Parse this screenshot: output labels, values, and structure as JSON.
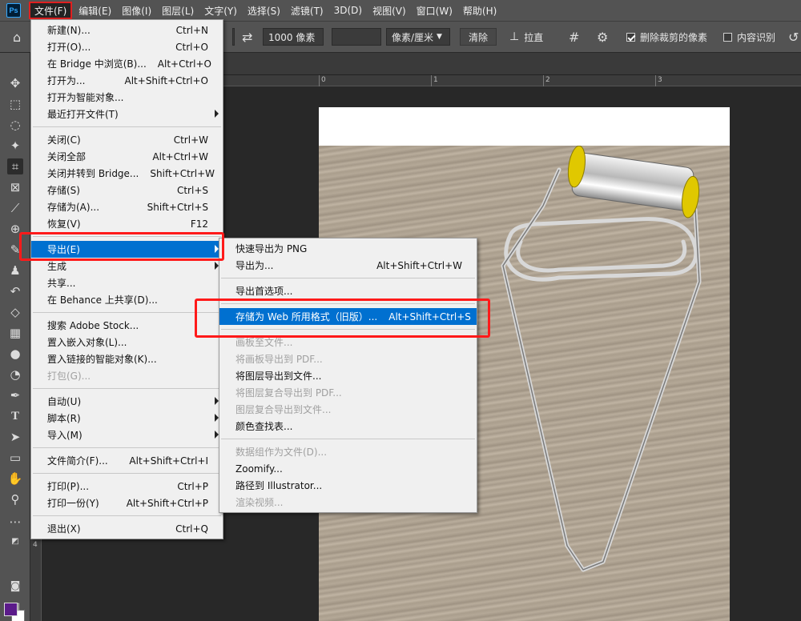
{
  "app": {
    "logo_text": "Ps"
  },
  "menubar": [
    "文件(F)",
    "编辑(E)",
    "图像(I)",
    "图层(L)",
    "文字(Y)",
    "选择(S)",
    "滤镜(T)",
    "3D(D)",
    "视图(V)",
    "窗口(W)",
    "帮助(H)"
  ],
  "options": {
    "height_value": "1000 像素",
    "unit_select": "像素/厘米",
    "clear_label": "清除",
    "straighten_label": "拉直",
    "delete_cropped_label": "删除裁剪的像素",
    "delete_cropped_checked": true,
    "content_aware_label": "内容识别",
    "content_aware_checked": false
  },
  "ruler": {
    "h0": "0",
    "h1": "1",
    "h2": "2",
    "h3": "3",
    "v4": "4"
  },
  "file_menu": [
    {
      "label": "新建(N)...",
      "shortcut": "Ctrl+N"
    },
    {
      "label": "打开(O)...",
      "shortcut": "Ctrl+O"
    },
    {
      "label": "在 Bridge 中浏览(B)...",
      "shortcut": "Alt+Ctrl+O"
    },
    {
      "label": "打开为...",
      "shortcut": "Alt+Shift+Ctrl+O"
    },
    {
      "label": "打开为智能对象...",
      "shortcut": ""
    },
    {
      "label": "最近打开文件(T)",
      "shortcut": "",
      "submenu": true
    },
    {
      "sep": true
    },
    {
      "label": "关闭(C)",
      "shortcut": "Ctrl+W"
    },
    {
      "label": "关闭全部",
      "shortcut": "Alt+Ctrl+W"
    },
    {
      "label": "关闭并转到 Bridge...",
      "shortcut": "Shift+Ctrl+W"
    },
    {
      "label": "存储(S)",
      "shortcut": "Ctrl+S"
    },
    {
      "label": "存储为(A)...",
      "shortcut": "Shift+Ctrl+S"
    },
    {
      "label": "恢复(V)",
      "shortcut": "F12"
    },
    {
      "sep": true
    },
    {
      "label": "导出(E)",
      "shortcut": "",
      "submenu": true,
      "highlighted": true
    },
    {
      "label": "生成",
      "shortcut": "",
      "submenu": true
    },
    {
      "label": "共享...",
      "shortcut": ""
    },
    {
      "label": "在 Behance 上共享(D)...",
      "shortcut": ""
    },
    {
      "sep": true
    },
    {
      "label": "搜索 Adobe Stock...",
      "shortcut": ""
    },
    {
      "label": "置入嵌入对象(L)...",
      "shortcut": ""
    },
    {
      "label": "置入链接的智能对象(K)...",
      "shortcut": ""
    },
    {
      "label": "打包(G)...",
      "shortcut": "",
      "disabled": true
    },
    {
      "sep": true
    },
    {
      "label": "自动(U)",
      "shortcut": "",
      "submenu": true
    },
    {
      "label": "脚本(R)",
      "shortcut": "",
      "submenu": true
    },
    {
      "label": "导入(M)",
      "shortcut": "",
      "submenu": true
    },
    {
      "sep": true
    },
    {
      "label": "文件简介(F)...",
      "shortcut": "Alt+Shift+Ctrl+I"
    },
    {
      "sep": true
    },
    {
      "label": "打印(P)...",
      "shortcut": "Ctrl+P"
    },
    {
      "label": "打印一份(Y)",
      "shortcut": "Alt+Shift+Ctrl+P"
    },
    {
      "sep": true
    },
    {
      "label": "退出(X)",
      "shortcut": "Ctrl+Q"
    }
  ],
  "export_menu": [
    {
      "label": "快速导出为 PNG",
      "shortcut": ""
    },
    {
      "label": "导出为...",
      "shortcut": "Alt+Shift+Ctrl+W"
    },
    {
      "sep": true
    },
    {
      "label": "导出首选项...",
      "shortcut": ""
    },
    {
      "sep": true
    },
    {
      "label": "存储为 Web 所用格式（旧版）...",
      "shortcut": "Alt+Shift+Ctrl+S",
      "highlighted": true
    },
    {
      "sep": true
    },
    {
      "label": "画板至文件...",
      "shortcut": "",
      "disabled": true
    },
    {
      "label": "将画板导出到 PDF...",
      "shortcut": "",
      "disabled": true
    },
    {
      "label": "将图层导出到文件...",
      "shortcut": ""
    },
    {
      "label": "将图层复合导出到 PDF...",
      "shortcut": "",
      "disabled": true
    },
    {
      "label": "图层复合导出到文件...",
      "shortcut": "",
      "disabled": true
    },
    {
      "label": "颜色查找表...",
      "shortcut": ""
    },
    {
      "sep": true
    },
    {
      "label": "数据组作为文件(D)...",
      "shortcut": "",
      "disabled": true
    },
    {
      "label": "Zoomify...",
      "shortcut": ""
    },
    {
      "label": "路径到 Illustrator...",
      "shortcut": ""
    },
    {
      "label": "渲染视频...",
      "shortcut": "",
      "disabled": true
    }
  ],
  "colors": {
    "accent": "#0070d0",
    "highlight_box": "#ff1a1a",
    "foreground": "#5b1b8a",
    "background": "#ffffff"
  }
}
